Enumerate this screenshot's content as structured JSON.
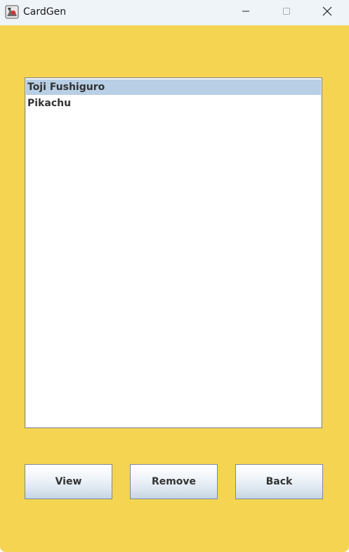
{
  "window": {
    "title": "CardGen"
  },
  "list": {
    "items": [
      {
        "label": "Toji Fushiguro",
        "selected": true
      },
      {
        "label": "Pikachu",
        "selected": false
      }
    ]
  },
  "buttons": {
    "view": "View",
    "remove": "Remove",
    "back": "Back"
  },
  "colors": {
    "background": "#f5d452",
    "selection": "#b8cfe5"
  }
}
